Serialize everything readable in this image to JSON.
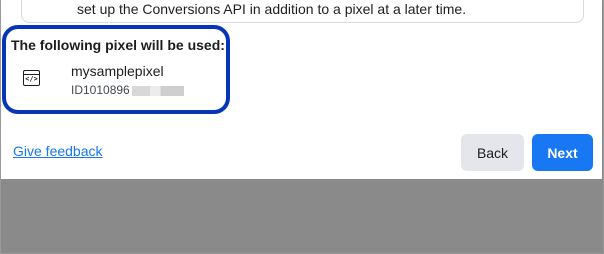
{
  "previous_text": "set up the Conversions API in addition to a pixel at a later time.",
  "pixel_section": {
    "heading": "The following pixel will be used:",
    "icon": "code-icon",
    "icon_glyph": "</>",
    "pixel_name": "mysamplepixel",
    "pixel_id_visible": "ID1010896",
    "pixel_id_redacted": true
  },
  "footer": {
    "feedback_link": "Give feedback",
    "back_label": "Back",
    "next_label": "Next"
  },
  "colors": {
    "primary": "#1877f2",
    "highlight": "#0636b6",
    "overlay": "#8a8a8a"
  }
}
